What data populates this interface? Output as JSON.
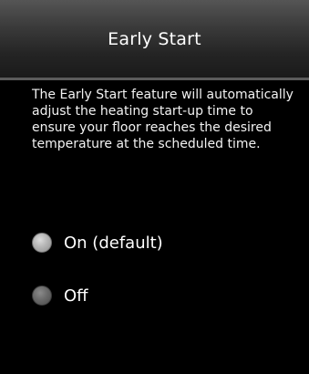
{
  "header": {
    "title": "Early Start"
  },
  "description": "The Early Start feature will automatically adjust the heating start-up time to ensure your floor reaches the desired temperature at the scheduled time.",
  "options": [
    {
      "label": "On (default)",
      "selected": true
    },
    {
      "label": "Off",
      "selected": false
    }
  ],
  "colors": {
    "background": "#000000",
    "header_gradient_top": "#555555",
    "header_gradient_bottom": "#1a1a1a",
    "text": "#ffffff"
  }
}
